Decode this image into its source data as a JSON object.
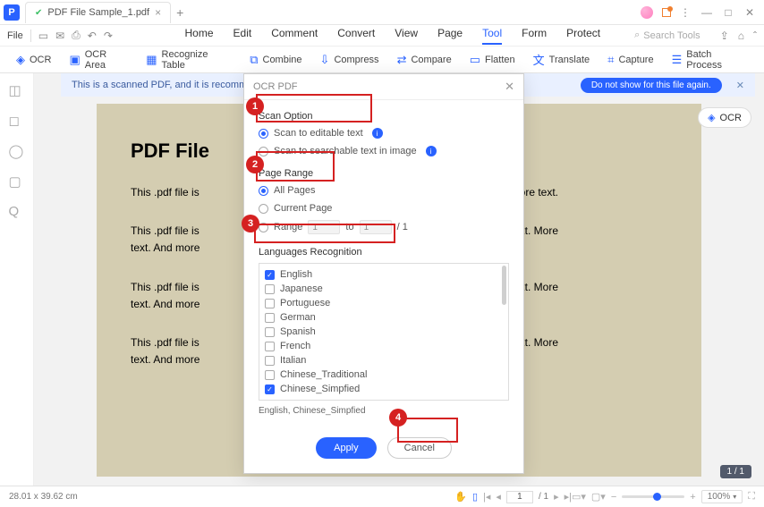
{
  "titlebar": {
    "tab_name": "PDF File Sample_1.pdf"
  },
  "qat": {
    "file": "File"
  },
  "menu": {
    "home": "Home",
    "edit": "Edit",
    "comment": "Comment",
    "convert": "Convert",
    "view": "View",
    "page": "Page",
    "tool": "Tool",
    "form": "Form",
    "protect": "Protect",
    "search_ph": "Search Tools"
  },
  "ribbon": {
    "ocr": "OCR",
    "ocr_area": "OCR Area",
    "recog": "Recognize Table",
    "combine": "Combine",
    "compress": "Compress",
    "compare": "Compare",
    "flatten": "Flatten",
    "translate": "Translate",
    "capture": "Capture",
    "batch": "Batch Process"
  },
  "banner": {
    "text": "This is a scanned PDF, and it is recommended",
    "btn2": "Do not show for this file again."
  },
  "page": {
    "title": "PDF File",
    "p1": "This .pdf file is",
    "p1b": "d more text.",
    "p2": "This .pdf file is",
    "p2b": "d more text. More",
    "p2c": "text. And more",
    "p3": "This .pdf file is",
    "p3b": "d more text. More",
    "p3c": "text. And more",
    "p4": "This .pdf file is",
    "p4b": "d more text. More",
    "p4c": "text. And more"
  },
  "ocr_btn": "OCR",
  "modal": {
    "title": "OCR PDF",
    "scan_option": "Scan Option",
    "scan_editable": "Scan to editable text",
    "scan_searchable": "Scan to searchable text in image",
    "page_range": "Page Range",
    "all_pages": "All Pages",
    "current_page": "Current Page",
    "range": "Range",
    "from": "1",
    "to_lbl": "to",
    "to": "1",
    "total": "/ 1",
    "lang_title": "Languages Recognition",
    "langs": [
      "English",
      "Japanese",
      "Portuguese",
      "German",
      "Spanish",
      "French",
      "Italian",
      "Chinese_Traditional",
      "Chinese_Simpfied"
    ],
    "lang_summary": "English,   Chinese_Simpfied",
    "apply": "Apply",
    "cancel": "Cancel"
  },
  "page_badge": "1 / 1",
  "status": {
    "coords": "28.01 x 39.62 cm",
    "page_cur": "1",
    "page_total": "/ 1",
    "zoom": "100%"
  },
  "callouts": {
    "n1": "1",
    "n2": "2",
    "n3": "3",
    "n4": "4"
  }
}
